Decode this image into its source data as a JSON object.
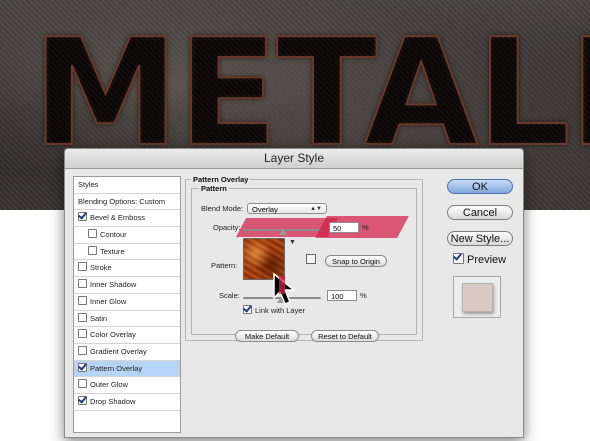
{
  "background": {
    "title": "METALIX"
  },
  "dialog": {
    "title": "Layer Style"
  },
  "sidebar": {
    "items": [
      {
        "label": "Styles",
        "checkbox": false,
        "checked": false,
        "indent": false,
        "selected": false
      },
      {
        "label": "Blending Options: Custom",
        "checkbox": false,
        "checked": false,
        "indent": false,
        "selected": false
      },
      {
        "label": "Bevel & Emboss",
        "checkbox": true,
        "checked": true,
        "indent": false,
        "selected": false
      },
      {
        "label": "Contour",
        "checkbox": true,
        "checked": false,
        "indent": true,
        "selected": false
      },
      {
        "label": "Texture",
        "checkbox": true,
        "checked": false,
        "indent": true,
        "selected": false
      },
      {
        "label": "Stroke",
        "checkbox": true,
        "checked": false,
        "indent": false,
        "selected": false
      },
      {
        "label": "Inner Shadow",
        "checkbox": true,
        "checked": false,
        "indent": false,
        "selected": false
      },
      {
        "label": "Inner Glow",
        "checkbox": true,
        "checked": false,
        "indent": false,
        "selected": false
      },
      {
        "label": "Satin",
        "checkbox": true,
        "checked": false,
        "indent": false,
        "selected": false
      },
      {
        "label": "Color Overlay",
        "checkbox": true,
        "checked": false,
        "indent": false,
        "selected": false
      },
      {
        "label": "Gradient Overlay",
        "checkbox": true,
        "checked": false,
        "indent": false,
        "selected": false
      },
      {
        "label": "Pattern Overlay",
        "checkbox": true,
        "checked": true,
        "indent": false,
        "selected": true
      },
      {
        "label": "Outer Glow",
        "checkbox": true,
        "checked": false,
        "indent": false,
        "selected": false
      },
      {
        "label": "Drop Shadow",
        "checkbox": true,
        "checked": true,
        "indent": false,
        "selected": false
      }
    ]
  },
  "panel": {
    "group_title": "Pattern Overlay",
    "subgroup_title": "Pattern",
    "blend_mode_label": "Blend Mode:",
    "blend_mode_value": "Overlay",
    "opacity_label": "Opacity:",
    "opacity_value": "50",
    "opacity_unit": "%",
    "pattern_label": "Pattern:",
    "snap_button": "Snap to Origin",
    "scale_label": "Scale:",
    "scale_value": "100",
    "scale_unit": "%",
    "link_label": "Link with Layer",
    "link_checked": true,
    "make_default": "Make Default",
    "reset_default": "Reset to Default"
  },
  "actions": {
    "ok": "OK",
    "cancel": "Cancel",
    "new_style": "New Style...",
    "preview_label": "Preview",
    "preview_checked": true
  },
  "colors": {
    "highlight": "#d21e46",
    "selection": "#b7d3f5",
    "pattern_base": "#b34a13"
  }
}
